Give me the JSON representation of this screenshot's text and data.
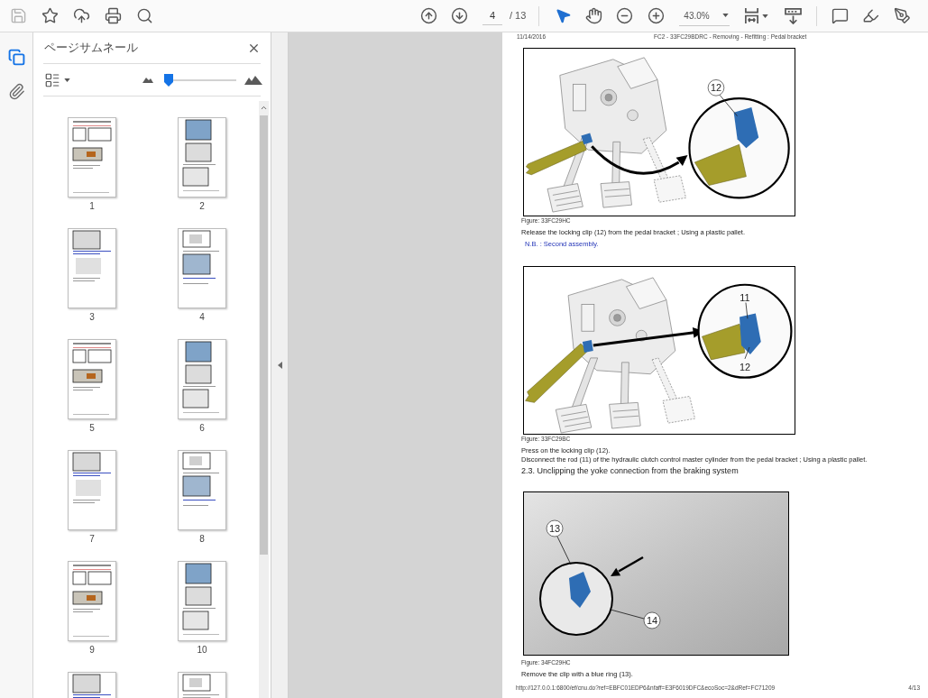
{
  "toolbar": {
    "file_buttons": [
      {
        "kind": "save",
        "disabled": true
      },
      {
        "kind": "bookmark",
        "disabled": false
      },
      {
        "kind": "upload",
        "disabled": false
      },
      {
        "kind": "print",
        "disabled": false
      },
      {
        "kind": "find",
        "disabled": false
      }
    ],
    "page_navigation": {
      "current_page": "4",
      "page_total": "/ 13"
    },
    "tool_buttons": [
      {
        "kind": "select",
        "selected": true
      },
      {
        "kind": "hand",
        "selected": false
      }
    ],
    "zoom": {
      "value": "43.0%"
    }
  },
  "rail": {
    "items": [
      {
        "kind": "thumbnails",
        "selected": true
      },
      {
        "kind": "attachments",
        "selected": false
      }
    ]
  },
  "sidebar": {
    "title": "ページサムネール",
    "thumbnail_size": {
      "level": 0.06
    },
    "thumbnails": [
      {
        "label": "1"
      },
      {
        "label": "2"
      },
      {
        "label": "3"
      },
      {
        "label": "4"
      },
      {
        "label": "5"
      },
      {
        "label": "6"
      },
      {
        "label": "7"
      },
      {
        "label": "8"
      },
      {
        "label": "9"
      },
      {
        "label": "10"
      }
    ]
  },
  "document": {
    "header": {
      "date": "11/14/2016",
      "title": "FC2 - 33FC29BDRC - Removing - Refitting : Pedal bracket"
    },
    "blocks": [
      {
        "kind": "drawing",
        "callouts": [
          "12"
        ],
        "caption": "Figure: 33FC29HC"
      },
      {
        "kind": "paragraph",
        "text": "Release the locking clip (12) from the pedal bracket ; Using a plastic pallet."
      },
      {
        "kind": "note",
        "text": "N.B. : Second assembly."
      },
      {
        "kind": "drawing",
        "callouts": [
          "11",
          "12"
        ],
        "caption": "Figure: 33FC29BC"
      },
      {
        "kind": "paragraph",
        "text": "Press on the locking clip (12)."
      },
      {
        "kind": "paragraph",
        "text": "Disconnect the rod (11) of the hydraulic clutch control master cylinder from the pedal bracket ; Using a plastic pallet."
      },
      {
        "kind": "heading",
        "text": "2.3. Unclipping the yoke connection from the braking system"
      },
      {
        "kind": "photo",
        "callouts": [
          "13",
          "14"
        ],
        "caption": "Figure: 34FC29HC"
      },
      {
        "kind": "paragraph",
        "text": "Remove the clip with a blue ring (13)."
      }
    ],
    "footer": {
      "url": "http://127.0.0.1:6800/ef/cnu.do?ref=EBFC01EDP6&nfaff=E3F6019DFC&ecoSoc=2&dRef=FC71209",
      "page": "4/13"
    }
  }
}
